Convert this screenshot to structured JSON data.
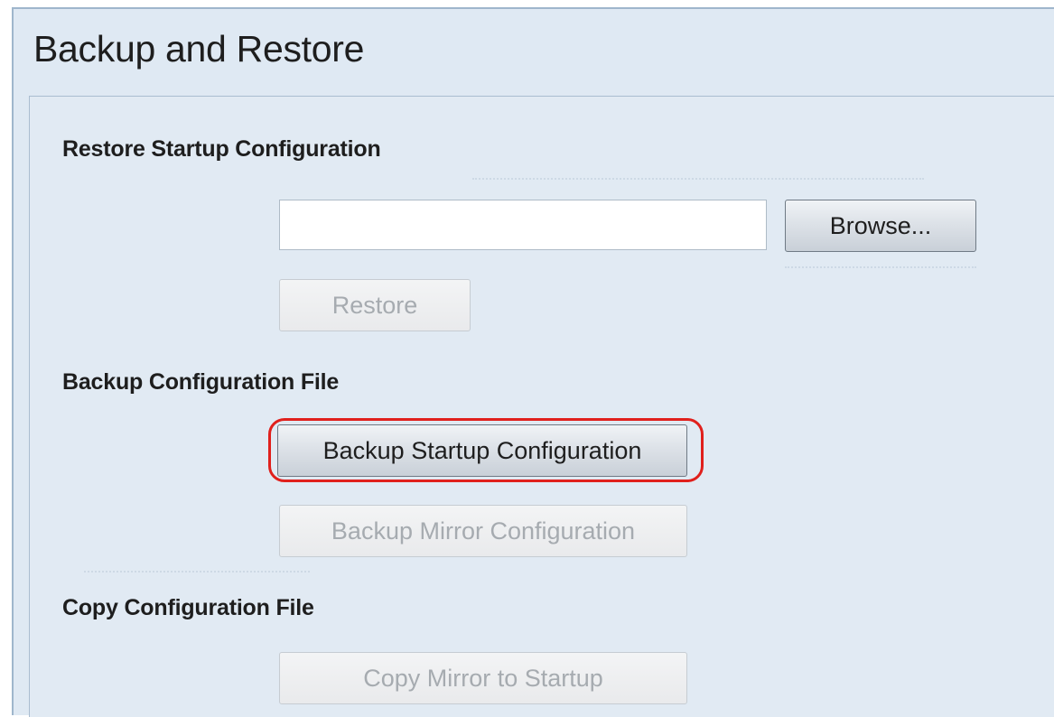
{
  "page": {
    "title": "Backup and Restore"
  },
  "sections": {
    "restore": {
      "heading": "Restore Startup Configuration",
      "file_input_value": "",
      "browse_label": "Browse...",
      "restore_label": "Restore"
    },
    "backup": {
      "heading": "Backup Configuration File",
      "backup_startup_label": "Backup Startup Configuration",
      "backup_mirror_label": "Backup Mirror Configuration"
    },
    "copy": {
      "heading": "Copy Configuration File",
      "copy_mirror_label": "Copy Mirror to Startup"
    }
  },
  "colors": {
    "highlight": "#e0201c",
    "background": "#e1eaf3"
  }
}
